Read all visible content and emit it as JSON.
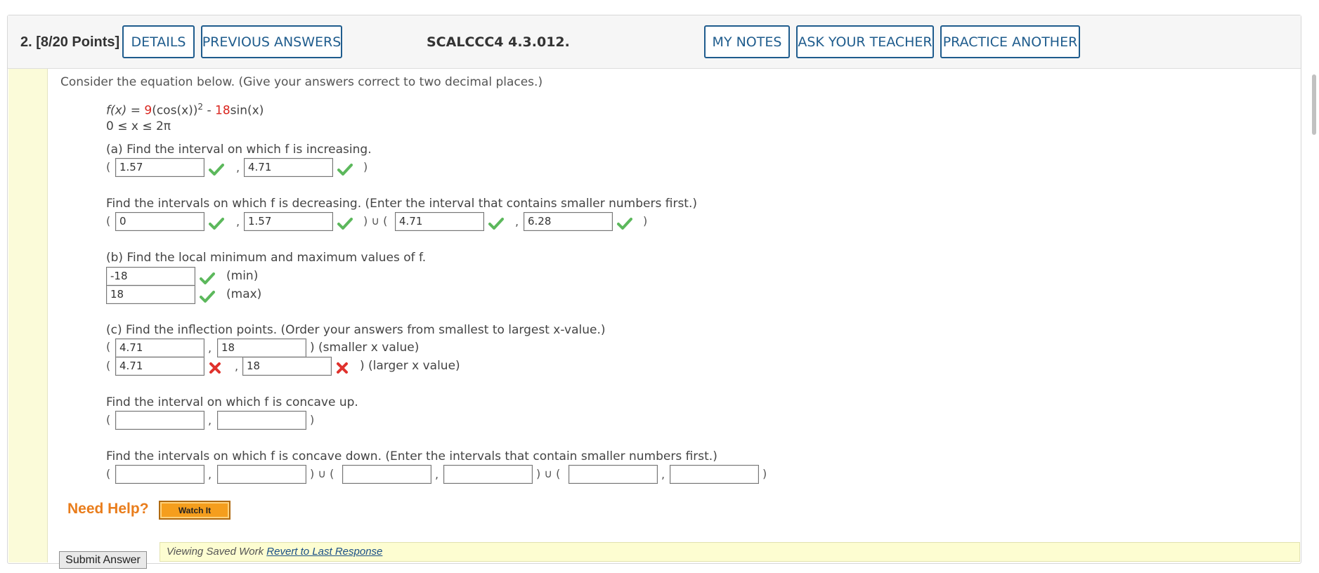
{
  "header": {
    "question_number": "2.",
    "points": "[8/20 Points]",
    "details_btn": "DETAILS",
    "previous_answers_btn": "PREVIOUS ANSWERS",
    "question_id": "SCALCCC4 4.3.012.",
    "my_notes_btn": "MY NOTES",
    "ask_teacher_btn": "ASK YOUR TEACHER",
    "practice_another_btn": "PRACTICE ANOTHER"
  },
  "question": {
    "intro": "Consider the equation below. (Give your answers correct to two decimal places.)",
    "equation": {
      "fx": "f(x)",
      "eq": " = ",
      "coef1": "9",
      "mid": "(cos(x))",
      "exp": "2",
      "minus": " - ",
      "coef2": "18",
      "tail": "sin(x)"
    },
    "domain": "0 ≤ x ≤ 2π",
    "part_a": {
      "increasing_prompt": "(a) Find the interval on which f is increasing.",
      "increasing": [
        "1.57",
        "4.71"
      ],
      "decreasing_prompt": "Find the intervals on which f is decreasing. (Enter the interval that contains smaller numbers first.)",
      "decreasing": [
        "0",
        "1.57",
        "4.71",
        "6.28"
      ]
    },
    "part_b": {
      "prompt": "(b) Find the local minimum and maximum values of f.",
      "min_value": "-18",
      "min_label": "(min)",
      "max_value": "18",
      "max_label": "(max)"
    },
    "part_c": {
      "prompt": "(c) Find the inflection points. (Order your answers from smallest to largest x-value.)",
      "smaller": [
        "4.71",
        "18"
      ],
      "smaller_label": ") (smaller x value)",
      "larger": [
        "4.71",
        "18"
      ],
      "larger_label": ") (larger x value)",
      "concave_up_prompt": "Find the interval on which f is concave up.",
      "concave_up": [
        "",
        ""
      ],
      "concave_down_prompt": "Find the intervals on which f is concave down. (Enter the intervals that contain smaller numbers first.)",
      "concave_down": [
        "",
        "",
        "",
        "",
        "",
        ""
      ]
    },
    "symbols": {
      "open": "(",
      "close": ")",
      "comma": ",",
      "union_open": ") ∪ ("
    }
  },
  "help": {
    "label": "Need Help?",
    "watch_btn": "Watch It"
  },
  "footer": {
    "submit_btn": "Submit Answer",
    "saved_text": "Viewing Saved Work ",
    "revert_link": "Revert to Last Response"
  },
  "colors": {
    "accent_blue": "#1f5c8d",
    "coefficient_red": "#d9241d",
    "correct_green": "#5cb85c",
    "incorrect_red": "#e0322d",
    "help_orange": "#e97d1c"
  }
}
